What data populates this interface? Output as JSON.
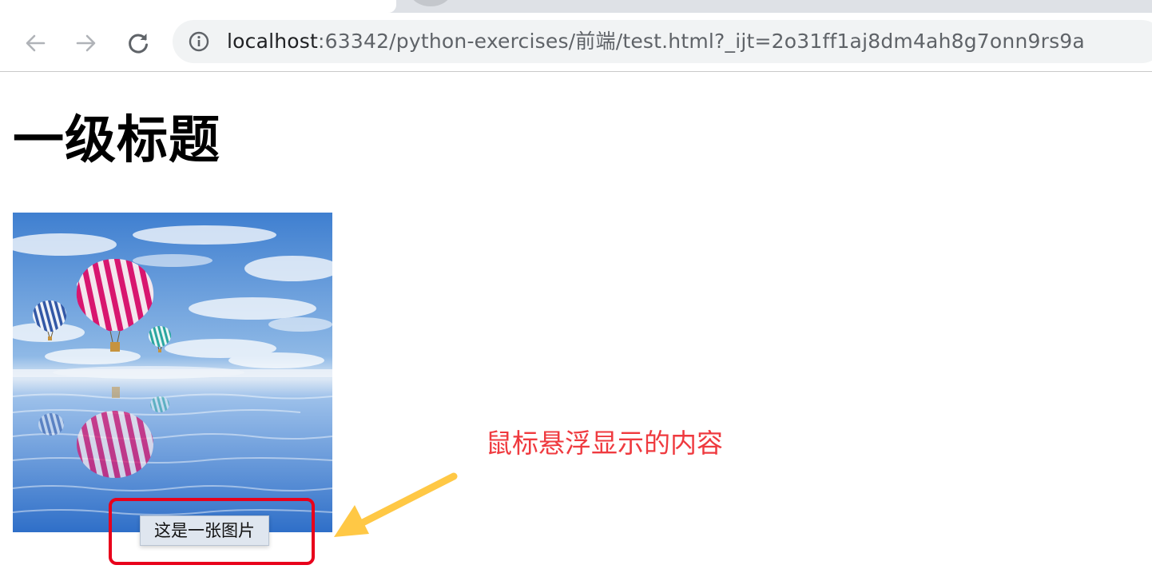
{
  "browser": {
    "url_host": "localhost",
    "url_rest": ":63342/python-exercises/前端/test.html?_ijt=2o31ff1aj8dm4ah8g7onn9rs9a"
  },
  "page": {
    "heading": "一级标题",
    "image_tooltip": "这是一张图片"
  },
  "annotation": {
    "text": "鼠标悬浮显示的内容",
    "color": "#ef3a3f",
    "box_color": "#e8001b",
    "arrow_color": "#ffc845"
  },
  "icons": {
    "back": "arrow-left-icon",
    "forward": "arrow-right-icon",
    "reload": "reload-icon",
    "site_info": "info-circle-icon"
  }
}
